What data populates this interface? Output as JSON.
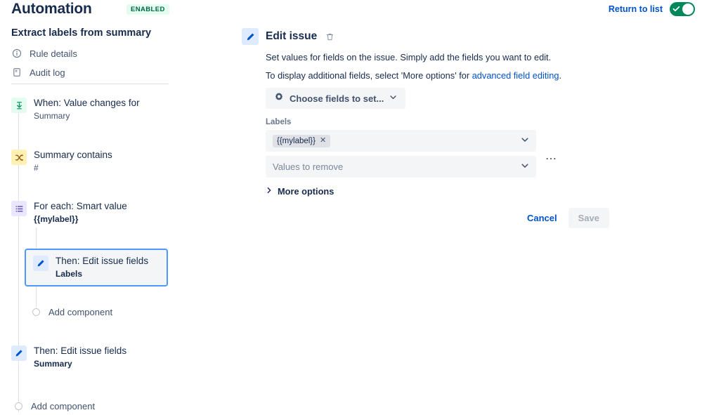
{
  "header": {
    "app_title": "Automation",
    "status_badge": "ENABLED",
    "return_link": "Return to list",
    "toggle_state": "on",
    "toggle_color": "#00875a"
  },
  "sidebar": {
    "rule_name": "Extract labels from summary",
    "nav_items": [
      {
        "label": "Rule details",
        "icon": "info-circle-icon"
      },
      {
        "label": "Audit log",
        "icon": "document-icon"
      }
    ],
    "components": [
      {
        "title": "When: Value changes for",
        "subtitle": "Summary",
        "icon": "trigger-icon",
        "color": "green",
        "selected": false
      },
      {
        "title": "Summary contains",
        "subtitle": "#",
        "icon": "condition-shuffle-icon",
        "color": "yellow",
        "selected": false
      },
      {
        "title": "For each: Smart value",
        "subtitle": "{{mylabel}}",
        "icon": "list-icon",
        "color": "purple",
        "selected": false
      },
      {
        "title": "Then: Edit issue fields",
        "subtitle": "Labels",
        "icon": "pencil-icon",
        "color": "blue",
        "selected": true
      },
      {
        "title": "Then: Edit issue fields",
        "subtitle": "Summary",
        "icon": "pencil-icon",
        "color": "blue",
        "selected": false
      }
    ],
    "add_component_label": "Add component",
    "add_component_label_2": "Add component"
  },
  "main": {
    "panel_icon": "pencil-icon",
    "title": "Edit issue",
    "delete_icon": "trash-icon",
    "description_line1": "Set values for fields on the issue. Simply add the fields you want to edit.",
    "description_line2_pre": "To display additional fields, select 'More options' for ",
    "description_line2_link": "advanced field editing",
    "description_line2_post": ".",
    "choose_fields_button": "Choose fields to set...",
    "choose_fields_icon": "gear-icon",
    "field_label": "Labels",
    "value_chip": "{{mylabel}}",
    "chip_remove_icon": "close-icon",
    "values_to_remove_placeholder": "Values to remove",
    "kebab_icon": "more-menu-icon",
    "more_options_label": "More options",
    "more_options_icon": "chevron-right-icon",
    "cancel_button": "Cancel",
    "save_button": "Save"
  }
}
